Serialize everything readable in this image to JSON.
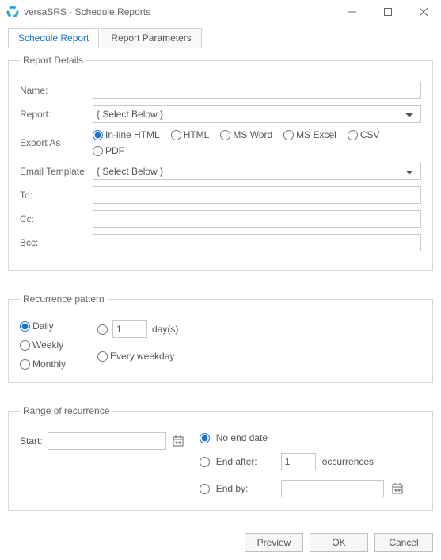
{
  "window": {
    "title": "versaSRS - Schedule Reports",
    "min_tooltip": "Minimize",
    "max_tooltip": "Maximize",
    "close_tooltip": "Close"
  },
  "tabs": {
    "schedule_report": "Schedule Report",
    "report_parameters": "Report Parameters"
  },
  "details": {
    "legend": "Report Details",
    "name_label": "Name:",
    "name_value": "",
    "report_label": "Report:",
    "report_selected": "{ Select Below }",
    "export_as_label": "Export As",
    "export": {
      "inline_html": "In-line HTML",
      "html": "HTML",
      "ms_word": "MS Word",
      "ms_excel": "MS Excel",
      "csv": "CSV",
      "pdf": "PDF"
    },
    "email_template_label": "Email Template:",
    "email_template_selected": "{ Select Below }",
    "to_label": "To:",
    "to_value": "",
    "cc_label": "Cc:",
    "cc_value": "",
    "bcc_label": "Bcc:",
    "bcc_value": ""
  },
  "recurrence": {
    "legend": "Recurrence pattern",
    "daily": "Daily",
    "weekly": "Weekly",
    "monthly": "Monthly",
    "days_value": "1",
    "days_suffix": "day(s)",
    "every_weekday": "Every weekday"
  },
  "range": {
    "legend": "Range of recurrence",
    "start_label": "Start:",
    "start_value": "",
    "no_end_date": "No end date",
    "end_after_label": "End after:",
    "end_after_value": "1",
    "occurrences": "occurrences",
    "end_by_label": "End by:",
    "end_by_value": ""
  },
  "footer": {
    "preview": "Preview",
    "ok": "OK",
    "cancel": "Cancel"
  }
}
